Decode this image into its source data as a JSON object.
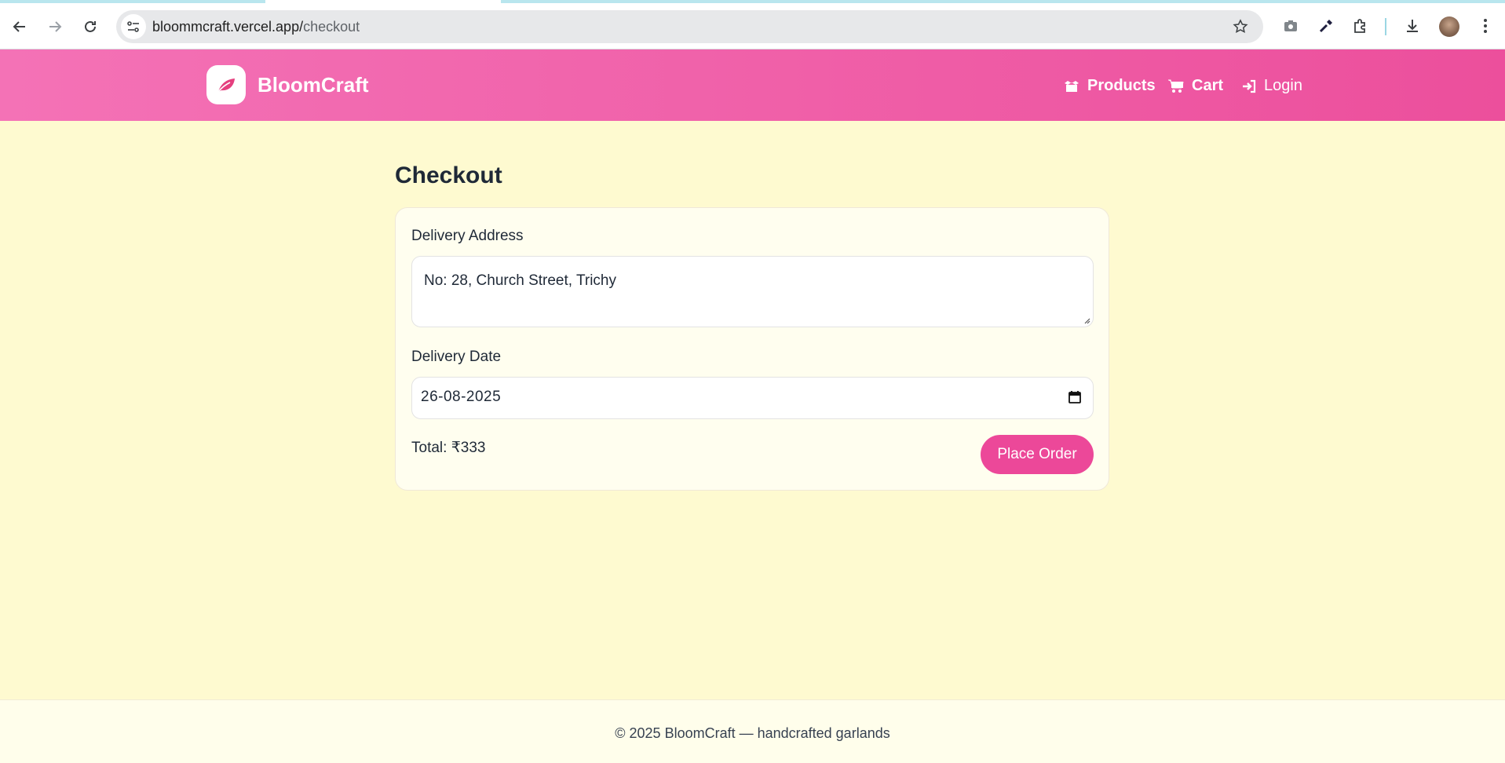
{
  "browser": {
    "url_host": "bloommcraft.vercel.app/",
    "url_path": "checkout",
    "icons": [
      "back-arrow-icon",
      "forward-arrow-icon",
      "reload-icon",
      "site-info-icon",
      "star-icon",
      "camera-icon",
      "eyedropper-icon",
      "extensions-icon",
      "download-icon",
      "profile-avatar",
      "more-menu-icon"
    ]
  },
  "header": {
    "brand_name": "BloomCraft",
    "nav": {
      "products": "Products",
      "cart": "Cart",
      "login": "Login"
    },
    "gradient_start": "#f472b6",
    "gradient_end": "#ec4f9c"
  },
  "checkout": {
    "title": "Checkout",
    "address_label": "Delivery Address",
    "address_value": "No: 28, Church Street, Trichy",
    "date_label": "Delivery Date",
    "date_value": "26-08-2025",
    "total": "Total: ₹333",
    "place_order": "Place Order"
  },
  "footer": {
    "text": "© 2025 BloomCraft — handcrafted garlands"
  },
  "colors": {
    "page_bg": "#fefad0",
    "accent": "#ec4899",
    "card_bg": "#fffeef"
  }
}
